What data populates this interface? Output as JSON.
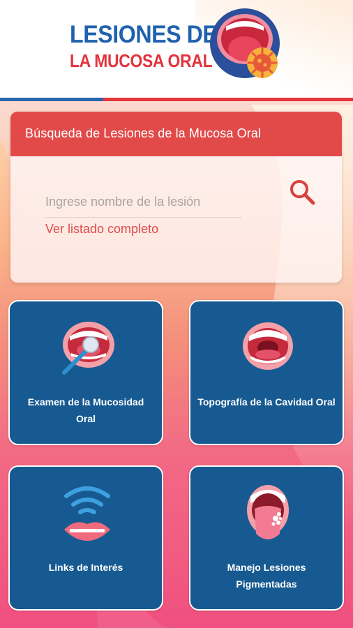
{
  "logo": {
    "line1": "LESIONES DE",
    "line2": "LA MUCOSA ORAL",
    "icon": "mouth-virus-icon"
  },
  "search": {
    "title": "Búsqueda de Lesiones de la Mucosa Oral",
    "placeholder": "Ingrese nombre de la lesión",
    "button_icon": "search-icon",
    "view_all": "Ver listado completo"
  },
  "tiles": [
    {
      "label": "Examen de la Mucosidad Oral",
      "icon": "mouth-mirror-icon"
    },
    {
      "label": "Topografía de la Cavidad Oral",
      "icon": "open-mouth-icon"
    },
    {
      "label": "Links de Interés",
      "icon": "lips-signal-icon"
    },
    {
      "label": "Manejo Lesiones Pigmentadas",
      "icon": "tongue-lesion-icon"
    }
  ],
  "colors": {
    "brand_blue": "#1f62ad",
    "brand_red": "#e2343d",
    "search_header": "#e24a4a",
    "tile_blue": "#175a91"
  }
}
